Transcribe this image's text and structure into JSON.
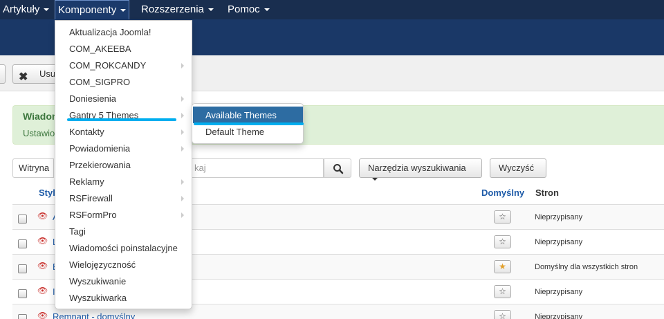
{
  "navbar": {
    "items": [
      {
        "label": "Artykuły"
      },
      {
        "label": "Komponenty"
      },
      {
        "label": "Rozszerzenia"
      },
      {
        "label": "Pomoc"
      }
    ]
  },
  "toolbar": {
    "delete_label": "Usu"
  },
  "alert": {
    "title": "Wiadom",
    "text": "Ustawio"
  },
  "filters": {
    "select_value": "Witryna",
    "search_placeholder": "kaj",
    "tools_label": "Narzędzia wyszukiwania",
    "clear_label": "Wyczyść"
  },
  "table": {
    "col_style": "Styl",
    "col_default": "Domyślny",
    "col_pages": "Stron",
    "rows": [
      {
        "name": "A",
        "default": false,
        "pages": "Nieprzypisany"
      },
      {
        "name": "L",
        "default": false,
        "pages": "Nieprzypisany"
      },
      {
        "name": "B",
        "default": true,
        "pages": "Domyślny dla wszystkich stron"
      },
      {
        "name": "I",
        "default": false,
        "pages": "Nieprzypisany"
      },
      {
        "name": "Remnant - domyślny",
        "default": false,
        "pages": "Nieprzypisany"
      }
    ]
  },
  "menu": {
    "items": [
      {
        "label": "Aktualizacja Joomla!",
        "has_sub": false
      },
      {
        "label": "COM_AKEEBA",
        "has_sub": false
      },
      {
        "label": "COM_ROKCANDY",
        "has_sub": true
      },
      {
        "label": "COM_SIGPRO",
        "has_sub": false
      },
      {
        "label": "Doniesienia",
        "has_sub": true
      },
      {
        "label": "Gantry 5 Themes",
        "has_sub": true
      },
      {
        "label": "Kontakty",
        "has_sub": true
      },
      {
        "label": "Powiadomienia",
        "has_sub": true
      },
      {
        "label": "Przekierowania",
        "has_sub": false
      },
      {
        "label": "Reklamy",
        "has_sub": true
      },
      {
        "label": "RSFirewall",
        "has_sub": true
      },
      {
        "label": "RSFormPro",
        "has_sub": true
      },
      {
        "label": "Tagi",
        "has_sub": false
      },
      {
        "label": "Wiadomości poinstalacyjne",
        "has_sub": false
      },
      {
        "label": "Wielojęzyczność",
        "has_sub": false
      },
      {
        "label": "Wyszukiwanie",
        "has_sub": false
      },
      {
        "label": "Wyszukiwarka",
        "has_sub": false
      }
    ]
  },
  "submenu": {
    "items": [
      {
        "label": "Available Themes"
      },
      {
        "label": "Default Theme"
      }
    ]
  },
  "colors": {
    "navbar": "#192e4f",
    "header": "#1a3867",
    "submenu_active": "#2d6ca2",
    "annotation": "#00aeef",
    "link": "#1e5ba8"
  }
}
